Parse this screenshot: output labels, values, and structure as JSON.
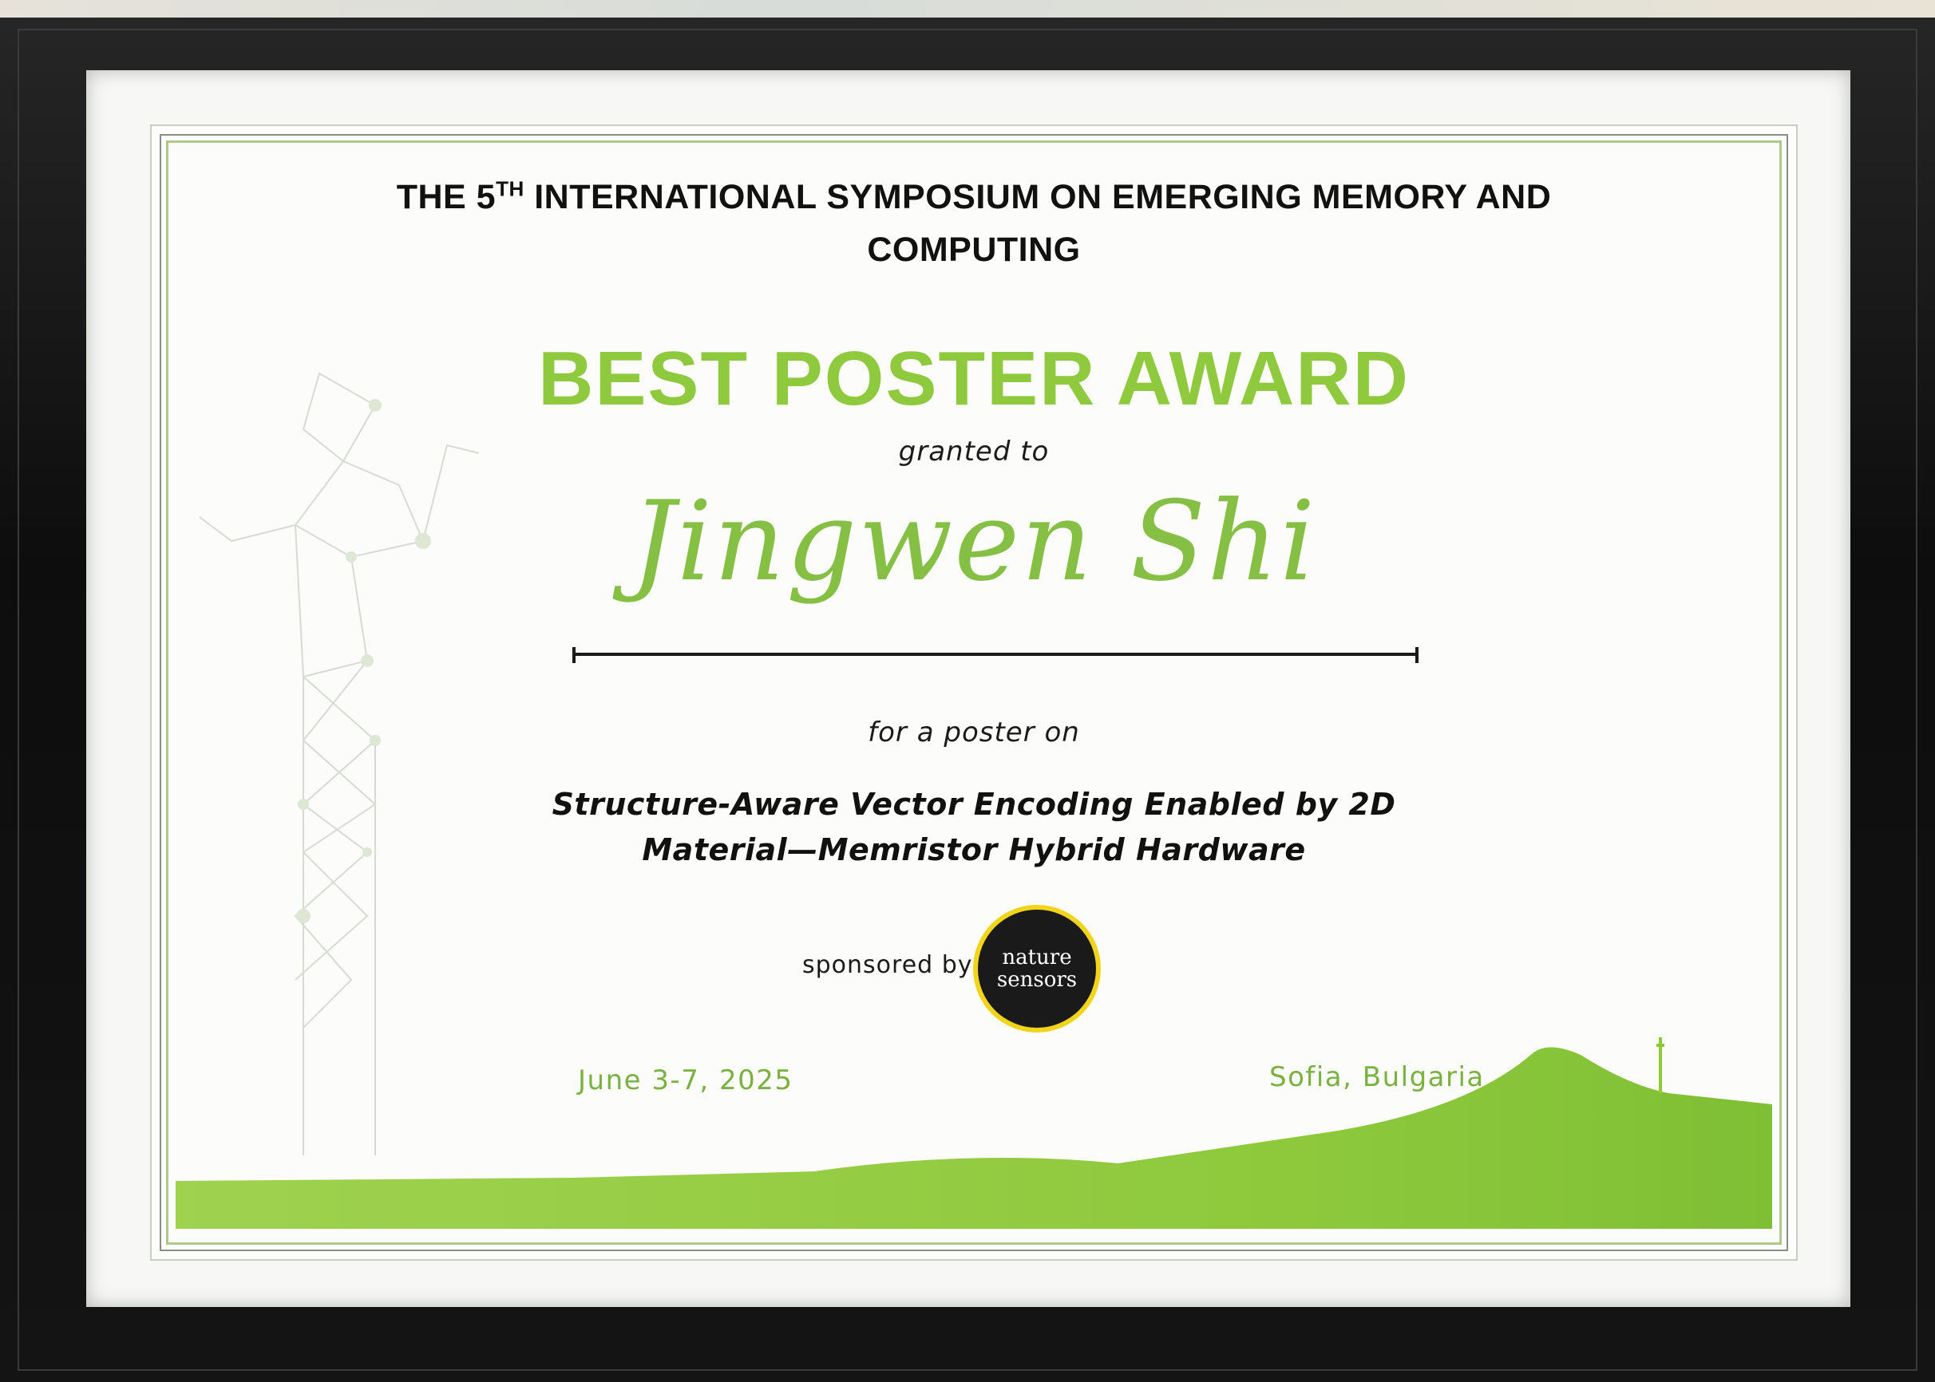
{
  "certificate": {
    "symposium_line1_pre": "THE 5",
    "symposium_line1_sup": "TH",
    "symposium_line1_post": " INTERNATIONAL SYMPOSIUM ON EMERGING MEMORY AND",
    "symposium_line2": "COMPUTING",
    "award_title": "BEST POSTER AWARD",
    "granted_to": "granted to",
    "recipient": "Jingwen Shi",
    "for_poster": "for a poster on",
    "poster_title_line1": "Structure-Aware Vector Encoding Enabled by 2D",
    "poster_title_line2": "Material—Memristor Hybrid Hardware",
    "sponsored_by": "sponsored by",
    "sponsor_logo_line1": "nature",
    "sponsor_logo_line2": "sensors",
    "date": "June 3-7, 2025",
    "location": "Sofia, Bulgaria"
  },
  "colors": {
    "accent_green": "#8fca3e",
    "frame": "#111111",
    "logo_ring": "#f2d51b"
  }
}
